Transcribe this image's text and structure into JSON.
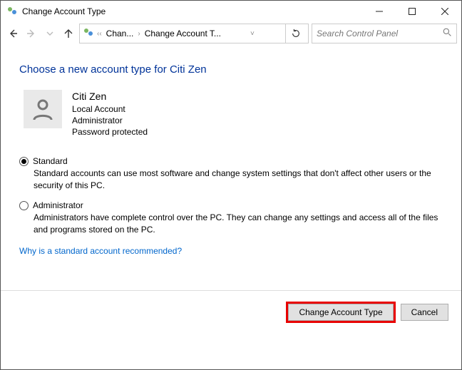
{
  "window": {
    "title": "Change Account Type"
  },
  "breadcrumb": {
    "seg1": "Chan...",
    "seg2": "Change Account T..."
  },
  "search": {
    "placeholder": "Search Control Panel"
  },
  "page": {
    "heading": "Choose a new account type for Citi Zen",
    "account": {
      "name": "Citi Zen",
      "line1": "Local Account",
      "line2": "Administrator",
      "line3": "Password protected"
    },
    "options": {
      "standard": {
        "label": "Standard",
        "desc": "Standard accounts can use most software and change system settings that don't affect other users or the security of this PC."
      },
      "administrator": {
        "label": "Administrator",
        "desc": "Administrators have complete control over the PC. They can change any settings and access all of the files and programs stored on the PC."
      }
    },
    "link": "Why is a standard account recommended?"
  },
  "buttons": {
    "change": "Change Account Type",
    "cancel": "Cancel"
  }
}
